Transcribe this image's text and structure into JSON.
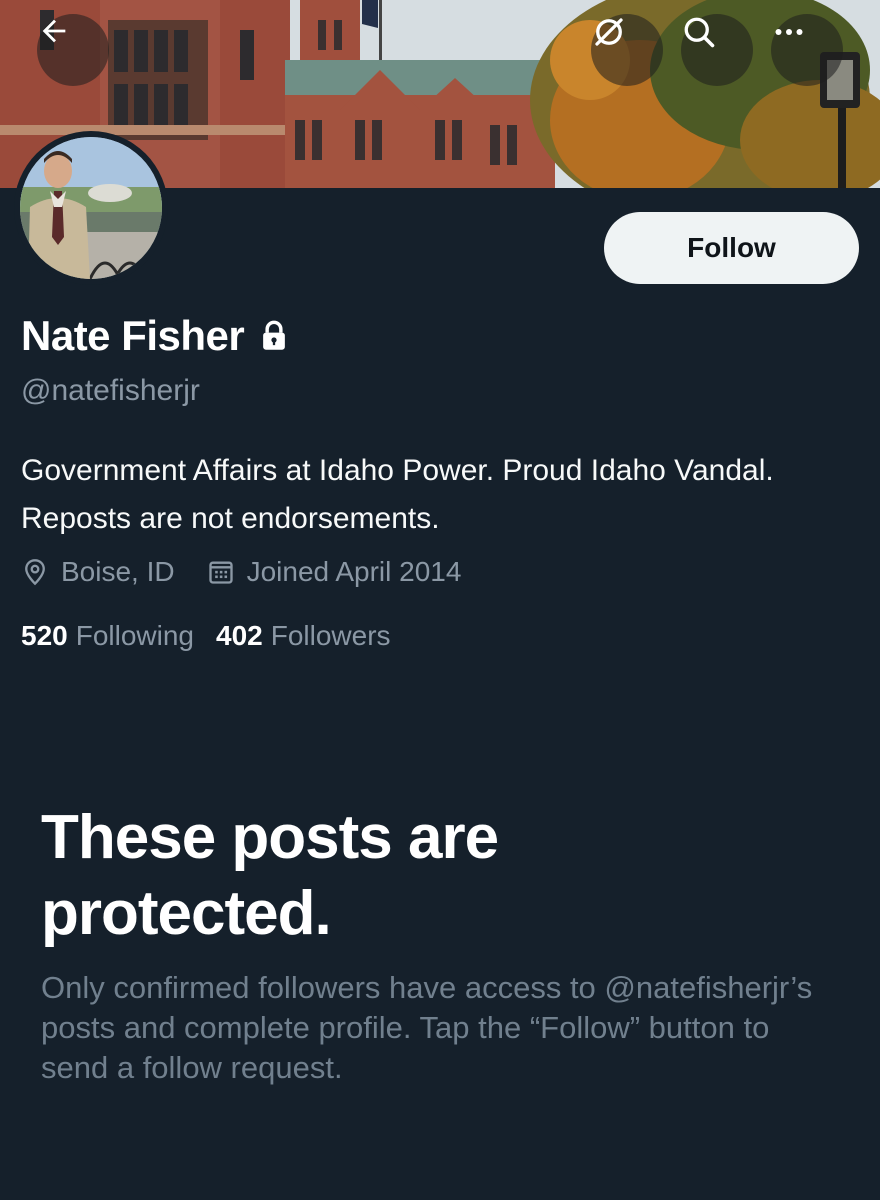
{
  "header": {
    "back_icon": "arrow-left-icon",
    "grok_icon": "grok-icon",
    "search_icon": "search-icon",
    "more_icon": "more-horizontal-icon"
  },
  "profile": {
    "name": "Nate Fisher",
    "handle": "@natefisherjr",
    "protected_icon": "lock-icon",
    "bio": "Government Affairs at Idaho Power. Proud Idaho Vandal. Reposts are not endorsements.",
    "location": "Boise, ID",
    "joined": "Joined April 2014",
    "following_count": "520",
    "following_label": "Following",
    "followers_count": "402",
    "followers_label": "Followers",
    "follow_button": "Follow"
  },
  "protected_notice": {
    "title": "These posts are protected.",
    "text": "Only confirmed followers have access to @natefisherjr’s posts and complete profile. Tap the “Follow” button to send a follow request."
  },
  "colors": {
    "background": "#15202b",
    "muted_text": "#8b98a5",
    "follow_button_bg": "#eff3f4"
  }
}
